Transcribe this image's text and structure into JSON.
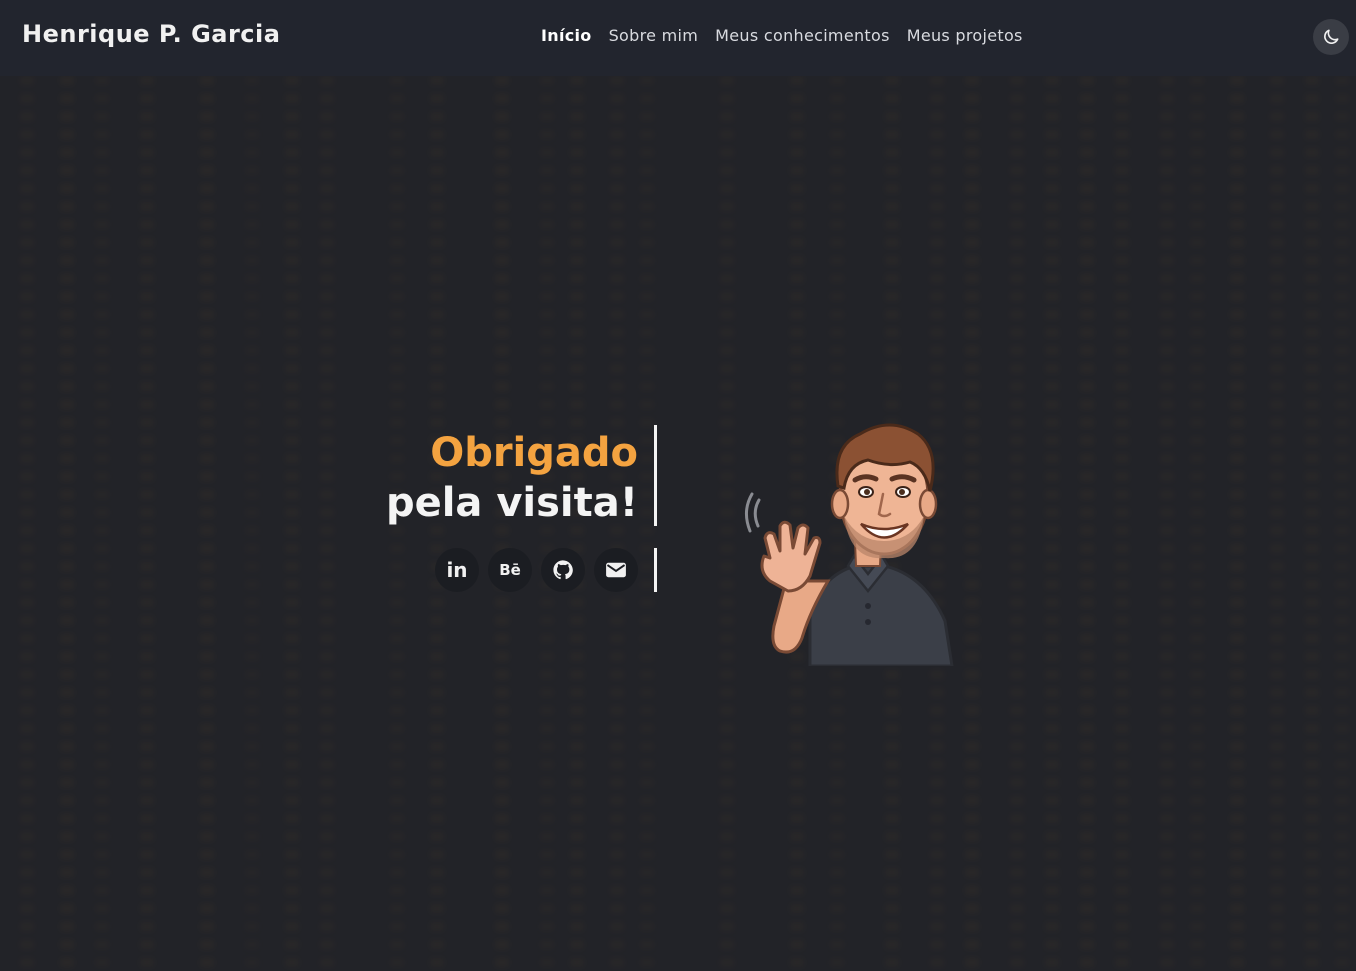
{
  "header": {
    "brand": "Henrique P. Garcia",
    "nav": [
      {
        "label": "Início",
        "active": true
      },
      {
        "label": "Sobre mim",
        "active": false
      },
      {
        "label": "Meus conhecimentos",
        "active": false
      },
      {
        "label": "Meus projetos",
        "active": false
      }
    ],
    "theme_toggle_icon": "moon-icon"
  },
  "hero": {
    "title_line1": "Obrigado",
    "title_line2": "pela visita!",
    "accent_color": "#f4a340",
    "social": [
      {
        "icon": "linkedin-icon",
        "label": "in"
      },
      {
        "icon": "behance-icon",
        "label": "Bē"
      },
      {
        "icon": "github-icon",
        "label": ""
      },
      {
        "icon": "email-icon",
        "label": ""
      }
    ],
    "avatar_icon": "waving-avatar-illustration"
  }
}
